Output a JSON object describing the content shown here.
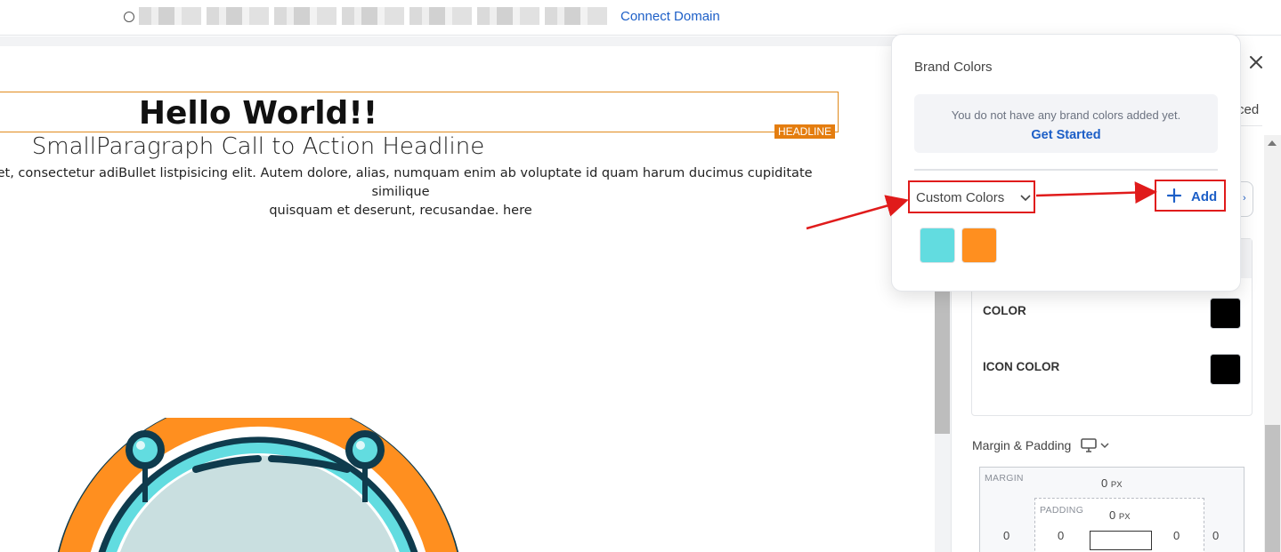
{
  "topbar": {
    "connect_domain": "Connect Domain"
  },
  "canvas": {
    "headline": "Hello World!!",
    "headline_tag": "HEADLINE",
    "subheadline": "SmallParagraph Call to Action Headline",
    "paragraph": "net, consectetur adiBullet listpisicing elit. Autem dolore, alias, numquam enim ab voluptate id quam harum ducimus cupiditate similique\nquisquam et deserunt, recusandae. here"
  },
  "panel": {
    "tab_partial": "ced",
    "color_label": "COLOR",
    "color_value": "#000000",
    "icon_color_label": "ICON COLOR",
    "icon_color_value": "#000000",
    "margin_padding_title": "Margin & Padding",
    "margin_label": "MARGIN",
    "padding_label": "PADDING",
    "margin_top": "0",
    "padding_top": "0",
    "margin_left": "0",
    "padding_left": "0",
    "padding_right": "0",
    "margin_right": "0",
    "unit": "PX"
  },
  "brand_popover": {
    "title": "Brand Colors",
    "notice": "You do not have any brand colors added yet.",
    "get_started": "Get  Started",
    "custom_colors_label": "Custom Colors",
    "add_label": "Add",
    "custom_swatches": [
      "#62dce0",
      "#ff8f1f"
    ]
  },
  "colors": {
    "accent": "#1d5fc7",
    "annotation": "#e01b1b",
    "headline_tag_bg": "#e47d0f"
  }
}
